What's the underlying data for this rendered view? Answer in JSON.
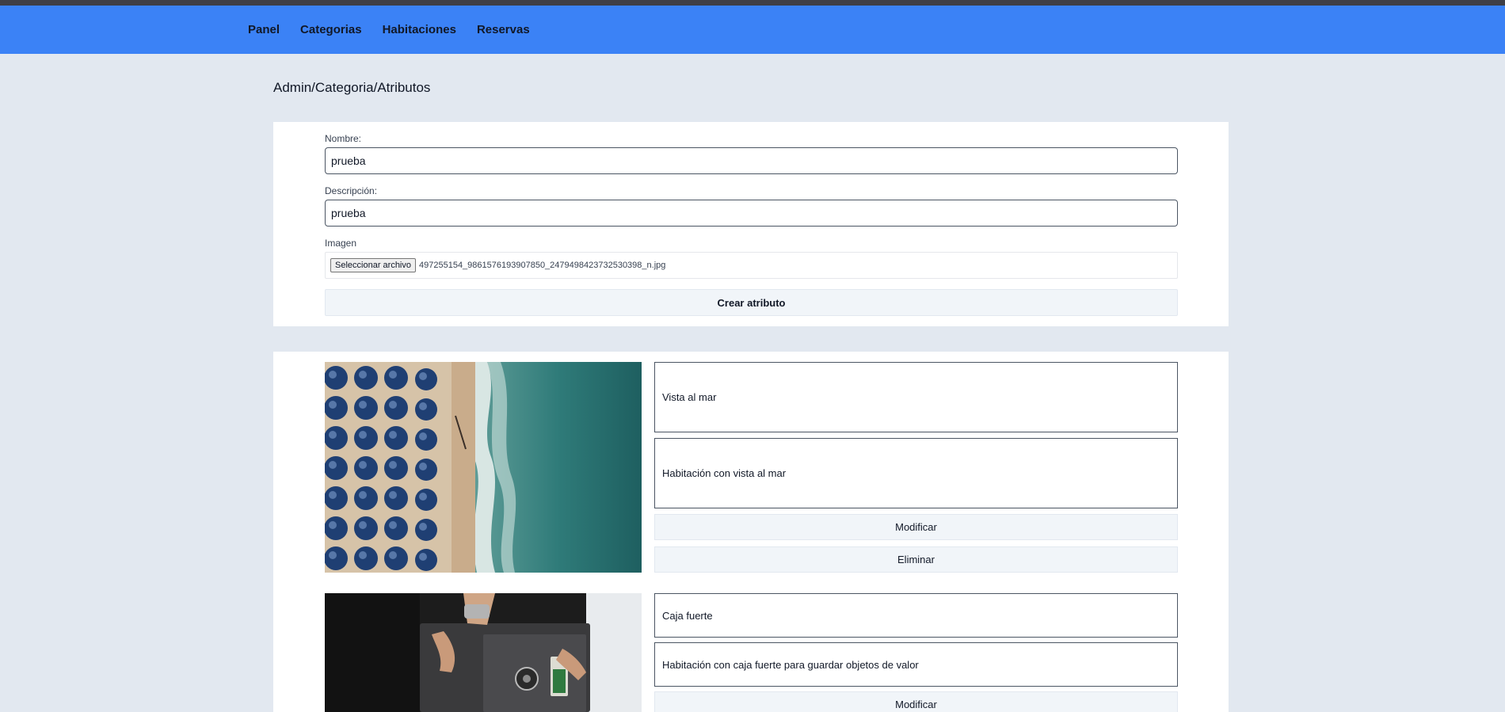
{
  "nav": {
    "items": [
      "Panel",
      "Categorias",
      "Habitaciones",
      "Reservas"
    ]
  },
  "breadcrumb": "Admin/Categoria/Atributos",
  "form": {
    "name_label": "Nombre:",
    "name_value": "prueba",
    "description_label": "Descripción:",
    "description_value": "prueba",
    "image_label": "Imagen",
    "file_button_label": "Seleccionar archivo",
    "file_name": "497255154_9861576193907850_2479498423732530398_n.jpg",
    "submit_label": "Crear atributo"
  },
  "attributes": [
    {
      "name": "Vista al mar",
      "description": "Habitación con vista al mar",
      "modify_label": "Modificar",
      "delete_label": "Eliminar"
    },
    {
      "name": "Caja fuerte",
      "description": "Habitación con caja fuerte para guardar objetos de valor",
      "modify_label": "Modificar"
    }
  ],
  "colors": {
    "navbar": "#3b82f6",
    "page_background": "#e2e8f0",
    "button_background": "#f1f5f9"
  }
}
